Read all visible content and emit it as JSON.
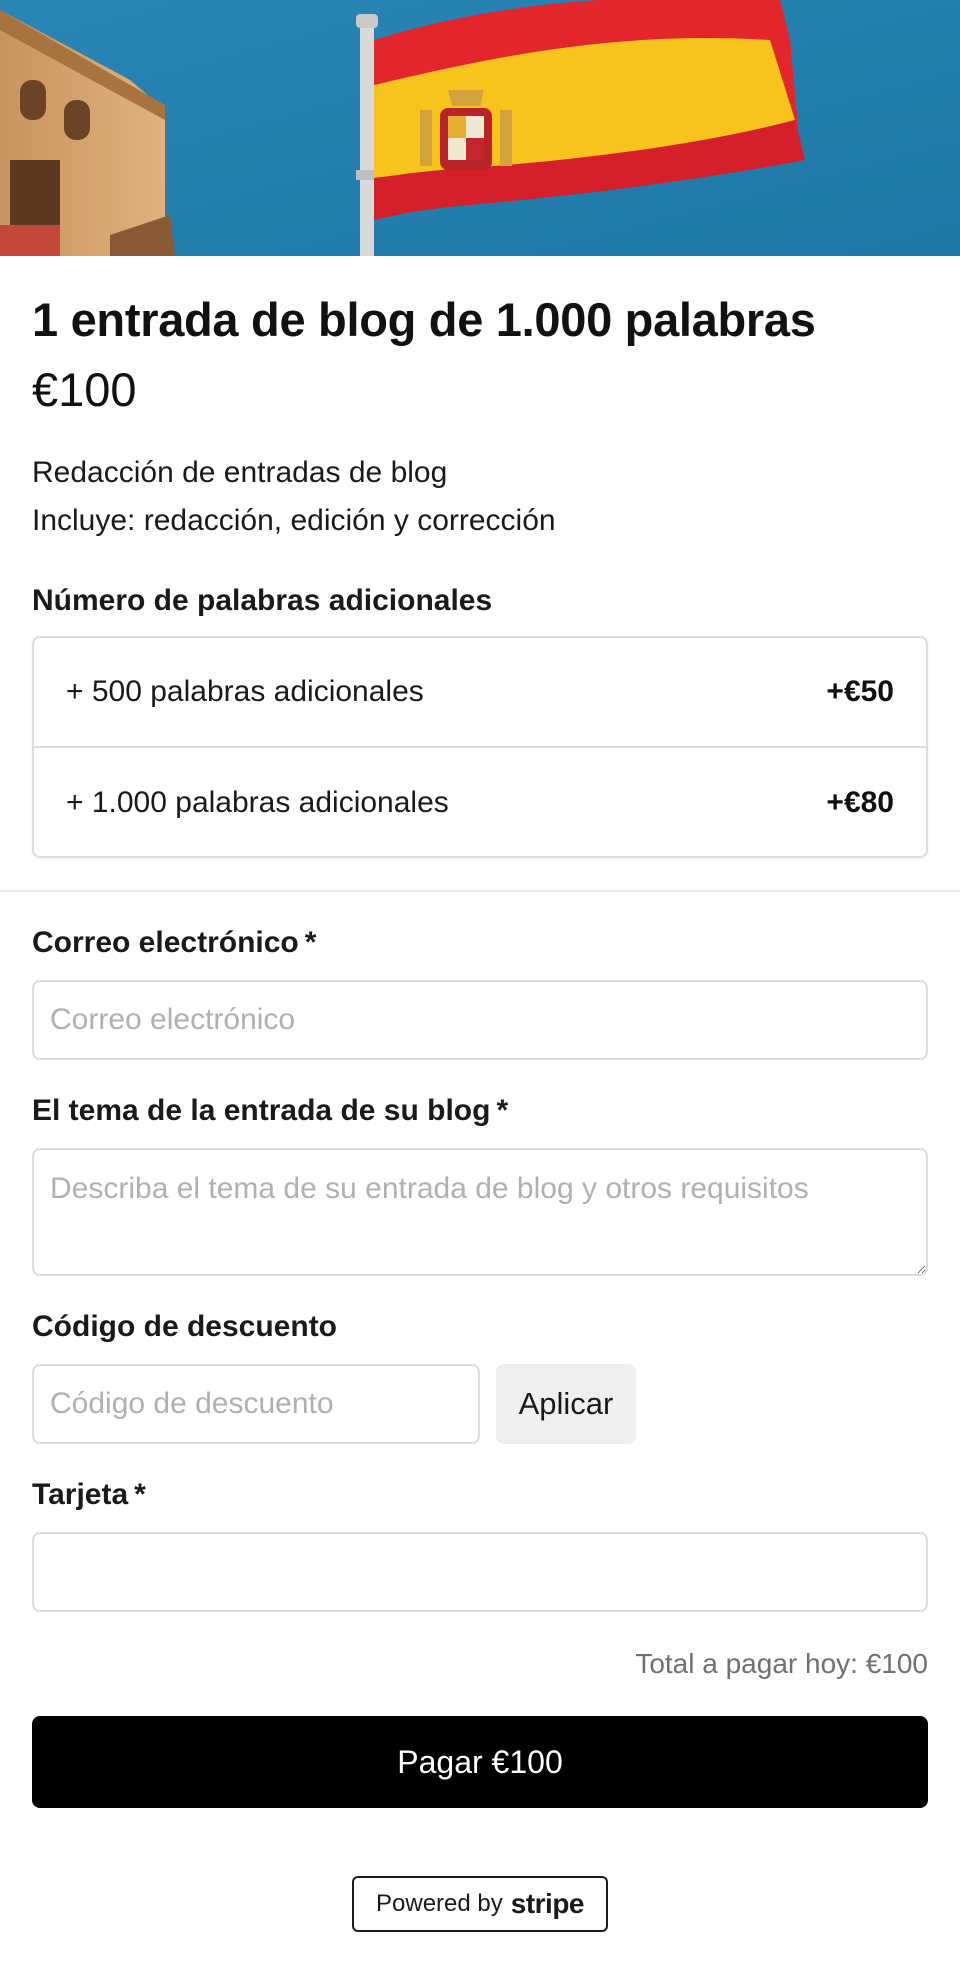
{
  "hero": {
    "image_alt": "Spanish flag waving next to a historic building against a blue sky"
  },
  "product": {
    "title": "1 entrada de blog de 1.000 palabras",
    "price": "€100",
    "description_lines": [
      "Redacción de entradas de blog",
      "Incluye: redacción, edición y corrección"
    ]
  },
  "addons": {
    "label": "Número de palabras adicionales",
    "options": [
      {
        "label": "+ 500 palabras adicionales",
        "price": "+€50"
      },
      {
        "label": "+ 1.000 palabras adicionales",
        "price": "+€80"
      }
    ]
  },
  "form": {
    "email": {
      "label": "Correo electrónico",
      "required_mark": "*",
      "placeholder": "Correo electrónico",
      "value": ""
    },
    "topic": {
      "label": "El tema de la entrada de su blog",
      "required_mark": "*",
      "placeholder": "Describa el tema de su entrada de blog y otros requisitos",
      "value": ""
    },
    "discount": {
      "label": "Código de descuento",
      "placeholder": "Código de descuento",
      "value": "",
      "apply_label": "Aplicar"
    },
    "card": {
      "label": "Tarjeta",
      "required_mark": "*",
      "value": ""
    }
  },
  "checkout": {
    "total_text": "Total a pagar hoy: €100",
    "pay_label": "Pagar €100"
  },
  "footer": {
    "powered_by": "Powered by",
    "brand": "stripe"
  },
  "colors": {
    "primary_button": "#000000",
    "border": "#dcdcdc",
    "placeholder": "#b0b0b0",
    "muted_text": "#707070"
  }
}
